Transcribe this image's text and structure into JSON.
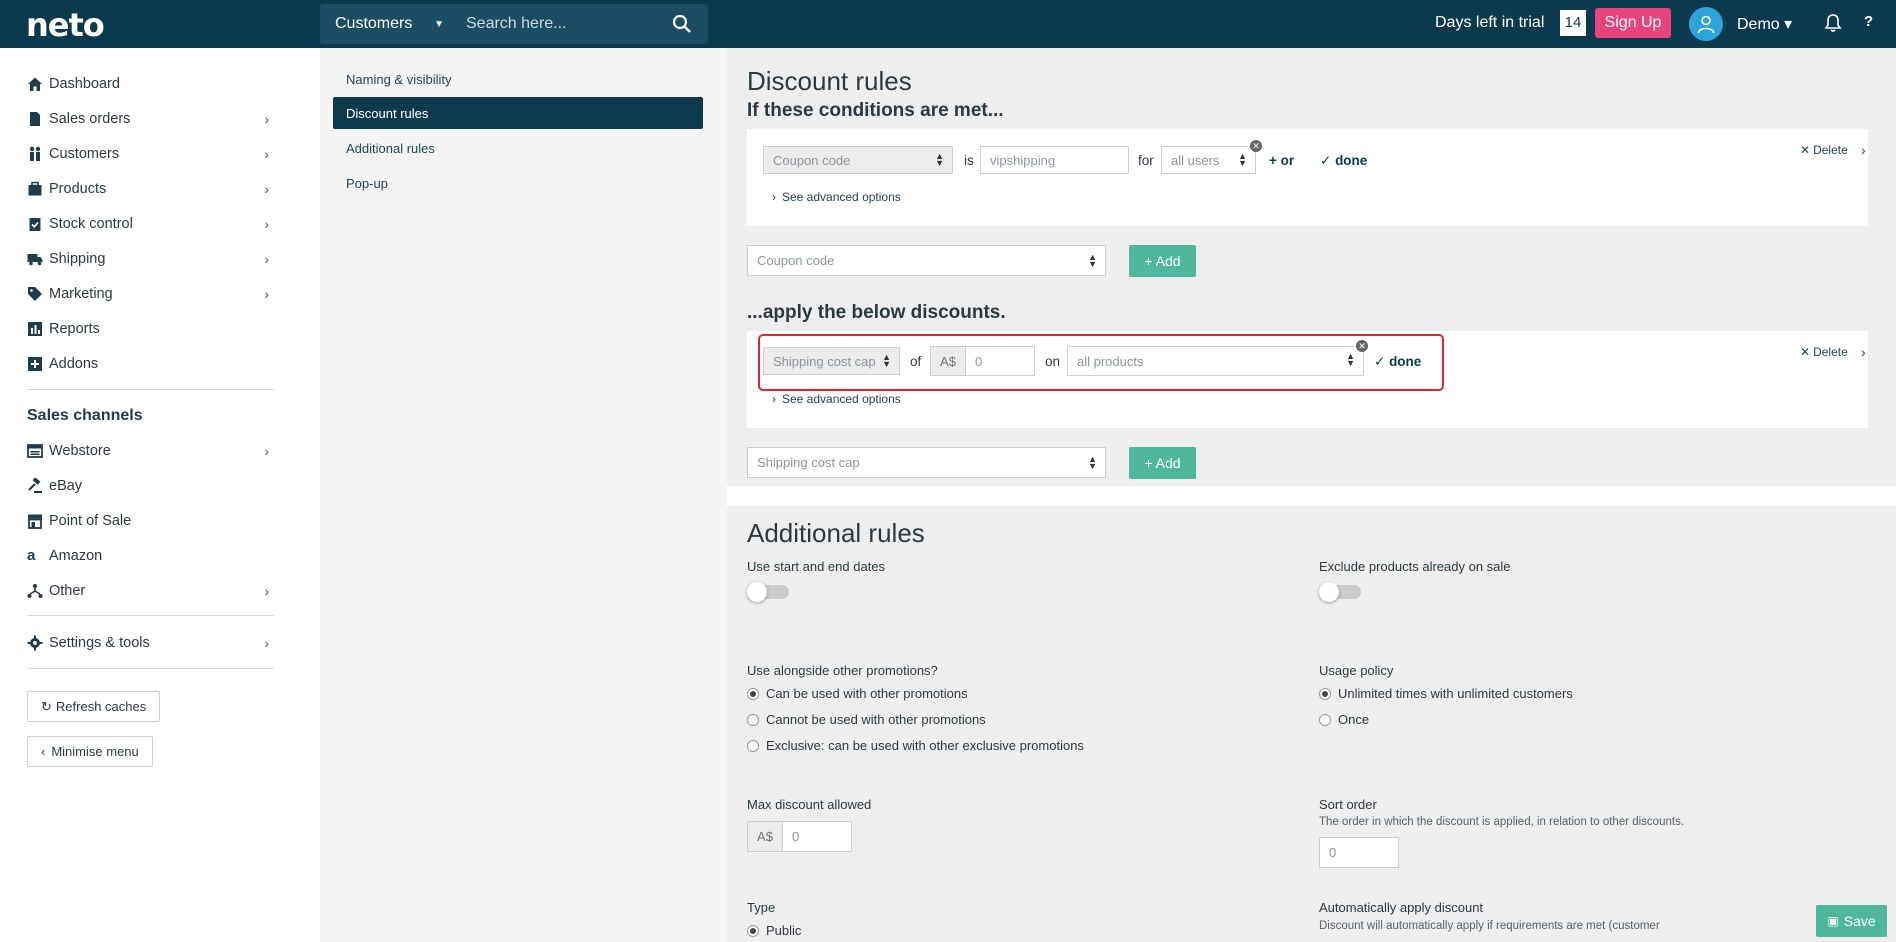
{
  "topbar": {
    "logo": "neto",
    "search_scope": "Customers",
    "search_placeholder": "Search here...",
    "trial_label": "Days left in trial",
    "trial_days": "14",
    "signup_label": "Sign Up",
    "user_name": "Demo ▾",
    "help_label": "?"
  },
  "sidebar": {
    "items": [
      {
        "label": "Dashboard"
      },
      {
        "label": "Sales orders"
      },
      {
        "label": "Customers"
      },
      {
        "label": "Products"
      },
      {
        "label": "Stock control"
      },
      {
        "label": "Shipping"
      },
      {
        "label": "Marketing"
      },
      {
        "label": "Reports"
      },
      {
        "label": "Addons"
      }
    ],
    "sales_channels_heading": "Sales channels",
    "channels": [
      {
        "label": "Webstore"
      },
      {
        "label": "eBay"
      },
      {
        "label": "Point of Sale"
      },
      {
        "label": "Amazon"
      },
      {
        "label": "Other"
      }
    ],
    "settings_label": "Settings & tools",
    "refresh_label": "Refresh caches",
    "minimise_label": "Minimise menu"
  },
  "submenu": {
    "items": [
      {
        "label": "Naming & visibility"
      },
      {
        "label": "Discount rules"
      },
      {
        "label": "Additional rules"
      },
      {
        "label": "Pop-up"
      }
    ]
  },
  "discount_rules": {
    "title": "Discount rules",
    "conditions_heading": "If these conditions are met...",
    "condition": {
      "field": "Coupon code",
      "is_label": "is",
      "value": "vipshipping",
      "for_label": "for",
      "users": "all users",
      "or_label": "+ or",
      "done_label": "done",
      "advanced_label": "See advanced options",
      "delete_label": "Delete"
    },
    "add_condition_select": "Coupon code",
    "add_label": "+ Add",
    "apply_heading": "...apply the below discounts.",
    "discount": {
      "type": "Shipping cost cap",
      "of_label": "of",
      "currency": "A$",
      "amount_placeholder": "0",
      "on_label": "on",
      "products": "all products",
      "done_label": "done",
      "advanced_label": "See advanced options",
      "delete_label": "Delete"
    },
    "add_discount_select": "Shipping cost cap"
  },
  "additional_rules": {
    "title": "Additional rules",
    "start_end_label": "Use start and end dates",
    "exclude_sale_label": "Exclude products already on sale",
    "alongside_label": "Use alongside other promotions?",
    "alongside_options": [
      {
        "label": "Can be used with other promotions",
        "checked": true
      },
      {
        "label": "Cannot be used with other promotions",
        "checked": false
      },
      {
        "label": "Exclusive: can be used with other exclusive promotions",
        "checked": false
      }
    ],
    "usage_label": "Usage policy",
    "usage_options": [
      {
        "label": "Unlimited times with unlimited customers",
        "checked": true
      },
      {
        "label": "Once",
        "checked": false
      }
    ],
    "max_discount_label": "Max discount allowed",
    "max_currency": "A$",
    "max_placeholder": "0",
    "sort_order_label": "Sort order",
    "sort_order_help": "The order in which the discount is applied, in relation to other discounts.",
    "sort_placeholder": "0",
    "type_label": "Type",
    "type_option": "Public",
    "auto_apply_label": "Automatically apply discount",
    "auto_apply_help": "Discount will automatically apply if requirements are met (customer"
  },
  "save_label": "Save",
  "colors": {
    "topbar": "#0b3a4f",
    "accent_green": "#4fb89c",
    "signup_pink": "#e8437c",
    "highlight_red": "#e0262b"
  }
}
